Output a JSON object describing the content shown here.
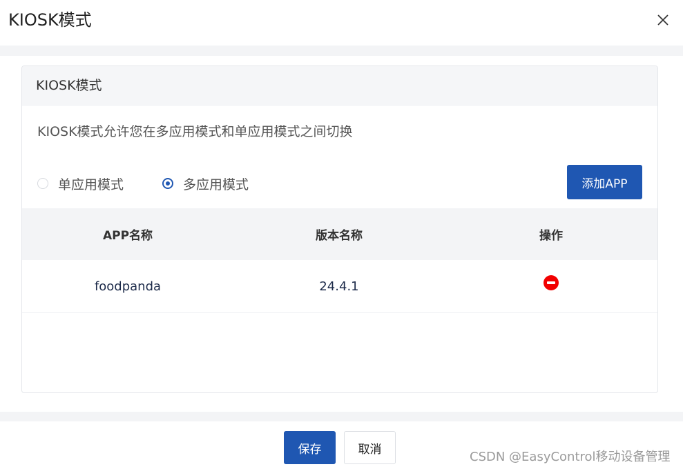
{
  "dialog": {
    "title": "KIOSK模式"
  },
  "card": {
    "header": "KIOSK模式",
    "description": "KIOSK模式允许您在多应用模式和单应用模式之间切换",
    "modes": [
      {
        "label": "单应用模式",
        "checked": false
      },
      {
        "label": "多应用模式",
        "checked": true
      }
    ],
    "add_button": "添加APP"
  },
  "table": {
    "columns": [
      "APP名称",
      "版本名称",
      "操作"
    ],
    "rows": [
      {
        "app_name": "foodpanda",
        "version": "24.4.1",
        "action_icon": "remove-circle-icon"
      }
    ]
  },
  "footer": {
    "save": "保存",
    "cancel": "取消"
  },
  "watermark": "CSDN @EasyControl移动设备管理",
  "colors": {
    "primary": "#1f57b2",
    "danger": "#f20000",
    "band": "#f3f4f6"
  }
}
